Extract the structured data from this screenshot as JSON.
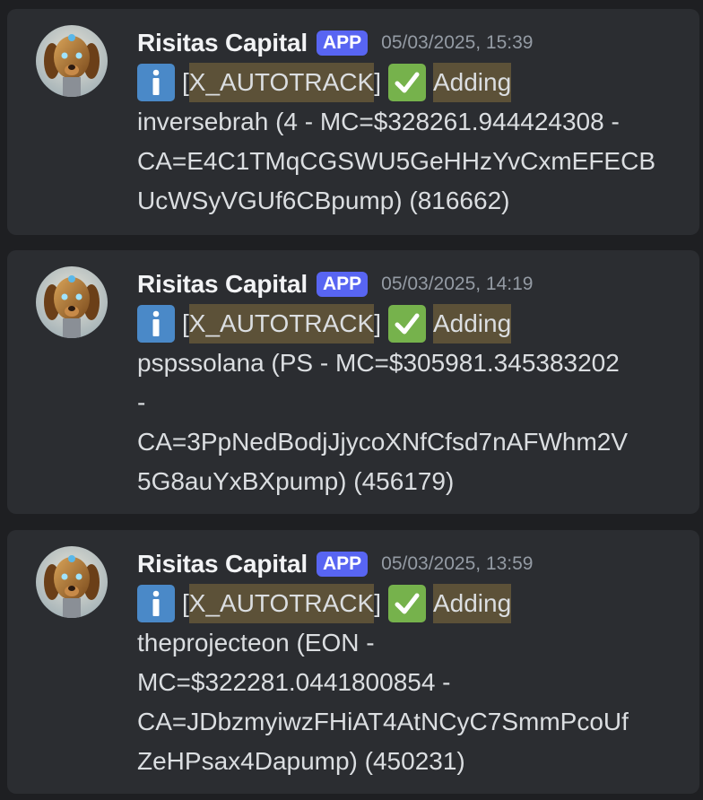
{
  "messages": [
    {
      "author": "Risitas Capital",
      "badge": "APP",
      "timestamp": "05/03/2025, 15:39",
      "tag_open": "[",
      "tag": "X_AUTOTRACK",
      "tag_close": "]",
      "action": "Adding",
      "lines": [
        "inversebrah (4 - MC=$328261.944424308 -",
        "CA=E4C1TMqCGSWU5GeHHzYvCxmEFECB",
        "UcWSyVGUf6CBpump) (816662)"
      ]
    },
    {
      "author": "Risitas Capital",
      "badge": "APP",
      "timestamp": "05/03/2025, 14:19",
      "tag_open": "[",
      "tag": "X_AUTOTRACK",
      "tag_close": "]",
      "action": "Adding",
      "lines": [
        "pspssolana (PS - MC=$305981.345383202",
        "-",
        "CA=3PpNedBodjJjycoXNfCfsd7nAFWhm2V",
        "5G8auYxBXpump) (456179)"
      ]
    },
    {
      "author": "Risitas Capital",
      "badge": "APP",
      "timestamp": "05/03/2025, 13:59",
      "tag_open": "[",
      "tag": "X_AUTOTRACK",
      "tag_close": "]",
      "action": "Adding",
      "lines": [
        "theprojecteon (EON -",
        "MC=$322281.0441800854 -",
        "CA=JDbzmyiwzFHiAT4AtNCyC7SmmPcoUf",
        "ZeHPsax4Dapump) (450231)"
      ]
    }
  ],
  "icons": {
    "info": "information-emoji-icon",
    "check": "check-mark-emoji-icon"
  },
  "colors": {
    "background": "#1e1f22",
    "card": "#2b2d31",
    "badge": "#5865f2",
    "highlight": "#5c5138",
    "info_emoji": "#4a89c8",
    "check_emoji": "#76b24c"
  }
}
